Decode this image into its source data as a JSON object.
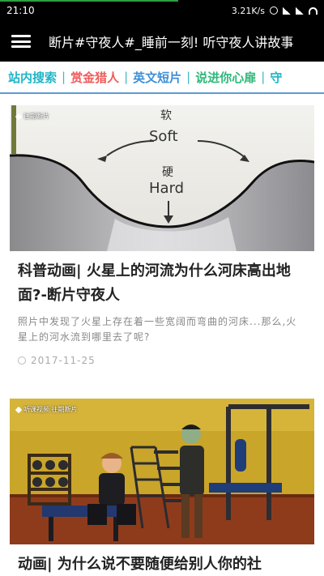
{
  "status_bar": {
    "time": "21:10",
    "network_speed": "3.21K/s",
    "load_progress": 0.55
  },
  "app_bar": {
    "title": "断片#守夜人#_睡前一刻! 听守夜人讲故事"
  },
  "tabs": [
    {
      "label": "站内搜索",
      "color": "#1fb5c7"
    },
    {
      "label": "赏金猎人",
      "color": "#f05a5a"
    },
    {
      "label": "英文短片",
      "color": "#3f8fd8"
    },
    {
      "label": "说进你心扉",
      "color": "#2eb87a"
    },
    {
      "label": "守",
      "color": "#1fb5c7"
    }
  ],
  "tab_separator": "|",
  "articles": [
    {
      "tags": "往期断片",
      "image_text": {
        "soft_cn": "软",
        "soft_en": "Soft",
        "hard_cn": "硬",
        "hard_en": "Hard"
      },
      "title": "科普动画| 火星上的河流为什么河床高出地面?-断片守夜人",
      "description": "照片中发现了火星上存在着一些宽阔而弯曲的河床...那么,火星上的河水流到哪里去了呢?",
      "date": "2017-11-25"
    },
    {
      "tags": "听课视频 往期断片",
      "title": "动画| 为什么说不要随便给别人你的社"
    }
  ]
}
